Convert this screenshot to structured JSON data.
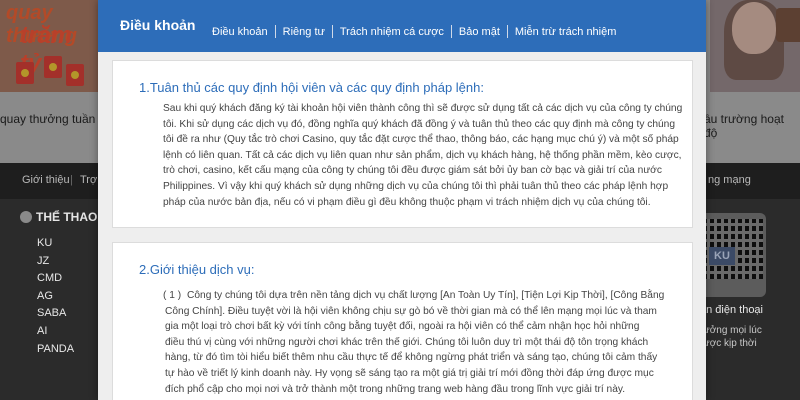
{
  "background": {
    "promo_left": {
      "line1": "quay thưởng",
      "line2": "trăm tỷ"
    },
    "ticker_left": "quay thưởng tuần trà",
    "ticker_right": "ầu trường hoạt độ",
    "navbar": {
      "items": [
        "Giới thiệu",
        "Trợ g",
        "ng mạng"
      ]
    },
    "sidebar": {
      "heading": "THỂ THAO",
      "items": [
        "KU",
        "JZ",
        "CMD",
        "AG",
        "SABA",
        "AI",
        "PANDA"
      ]
    },
    "qr": {
      "logo": "KU",
      "label": "ản điện thoại",
      "sub_line1": "ưởng mọi lúc",
      "sub_line2": "ược kịp thời"
    }
  },
  "modal": {
    "title": "Điều khoản",
    "tabs": [
      "Điều khoản",
      "Riêng tư",
      "Trách nhiệm cá cược",
      "Bảo mật",
      "Miễn trừ trách nhiệm"
    ],
    "sections": [
      {
        "title": "1.Tuân thủ các quy định hội viên và các quy định pháp lệnh:",
        "lines": [
          "Sau khi quý khách đăng ký tài khoản hội viên thành công thì sẽ được sử dụng tất cả các dịch vụ của công ty chúng",
          "tôi. Khi sử dụng các dịch vụ đó, đồng nghĩa quý khách đã đồng ý và tuân thủ theo các quy định mà công ty chúng",
          "tôi đề ra như (Quy tắc trò chơi Casino, quy tắc đặt cược thể thao, thông báo, các hạng mục chú ý) và một số pháp",
          "lệnh có liên quan. Tất cả các dịch vụ liên quan như sản phẩm, dịch vụ khách hàng, hệ thống phần mềm, kèo cược,",
          "trò chơi, casino, kết cấu mạng của công ty chúng tôi đều được giám sát bởi ủy ban cờ bạc và giải trí của nước",
          "Philippines. Vì vậy khi quý khách sử dụng những dịch vụ của chúng tôi thì phải tuân thủ theo các pháp lệnh hợp",
          "pháp của nước bản địa, nếu có vi phạm điều gì đều không thuộc phạm vi trách nhiệm dịch vụ của chúng tôi."
        ]
      },
      {
        "title": "2.Giới thiệu dịch vụ:",
        "number": "( 1 )",
        "lines": [
          "Công ty chúng tôi dựa trên nền tảng dịch vụ chất lượng [An Toàn Uy Tín], [Tiện Lợi Kịp Thời], [Công Bằng",
          "Công Chính]. Điều tuyệt vời là hội viên không chịu sự gò bó về thời gian mà có thể lên mạng mọi lúc và tham",
          "gia một loại trò chơi bất kỳ với tính công bằng tuyệt đối, ngoài ra hội viên có thể cảm nhận học hỏi những",
          "điều thú vị cùng với những người chơi khác trên thế giới. Chúng tôi luôn duy trì một thái độ tôn trọng khách",
          "hàng, từ đó tìm tòi hiểu biết thêm nhu cầu thực tế để không ngừng phát triển và sáng tạo, chúng tôi cảm thấy",
          "tự hào về triết lý kinh doanh này. Hy vọng sẽ sáng tạo ra một giá trị giải trí mới đồng thời đáp ứng được mục",
          "đích phổ cập cho mọi nơi và trở thành một trong những trang web hàng đầu trong lĩnh vực giải trí này."
        ]
      }
    ]
  }
}
